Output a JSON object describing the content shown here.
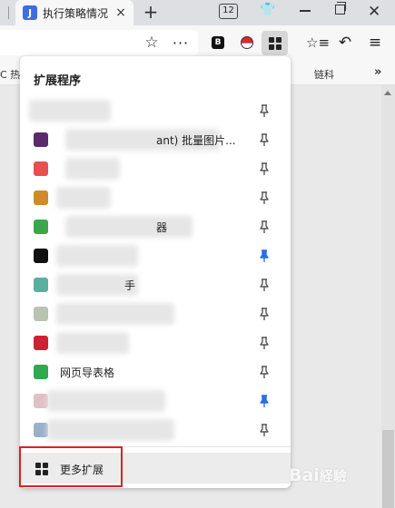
{
  "browser": {
    "tab": {
      "title": "执行策略情况",
      "favicon": "J",
      "close_glyph": "×"
    },
    "new_tab_glyph": "+",
    "tab_count": "12",
    "shirt_glyph": "👕",
    "win_close_glyph": "✕"
  },
  "toolbar": {
    "star_glyph": "☆",
    "dots_glyph": "···",
    "ext_b_label": "B",
    "favorites_glyph": "☆≡",
    "undo_glyph": "↶",
    "menu_glyph": "≡"
  },
  "bookmarks": {
    "left_text": "C 热",
    "right_text": "链科",
    "more_glyph": "»"
  },
  "panel": {
    "title": "扩展程序",
    "items": [
      {
        "name": "",
        "icon_color": "#f0f0f0",
        "pinned": false
      },
      {
        "name": "ant) 批量图片...",
        "icon_color": "#5a2a6b",
        "pinned": false
      },
      {
        "name": "",
        "icon_color": "#e85050",
        "pinned": false
      },
      {
        "name": "",
        "icon_color": "#d08a2a",
        "pinned": false
      },
      {
        "name": "器",
        "icon_color": "#3aa84a",
        "pinned": false
      },
      {
        "name": "",
        "icon_color": "#111111",
        "pinned": true
      },
      {
        "name": "手",
        "icon_color": "#5ab0a0",
        "pinned": false
      },
      {
        "name": "",
        "icon_color": "#b8c4b0",
        "pinned": false
      },
      {
        "name": "",
        "icon_color": "#cc2233",
        "pinned": false
      },
      {
        "name": "网页导表格",
        "icon_color": "#2fa84f",
        "pinned": false
      },
      {
        "name": "",
        "icon_color": "#e0c0c8",
        "pinned": true
      },
      {
        "name": "",
        "icon_color": "#9ab0c8",
        "pinned": false
      }
    ],
    "more_label": "更多扩展"
  },
  "colors": {
    "pin_active": "#2b6de8",
    "pin_inactive": "#555555",
    "highlight": "#e02020"
  },
  "watermark": "Bai經驗"
}
